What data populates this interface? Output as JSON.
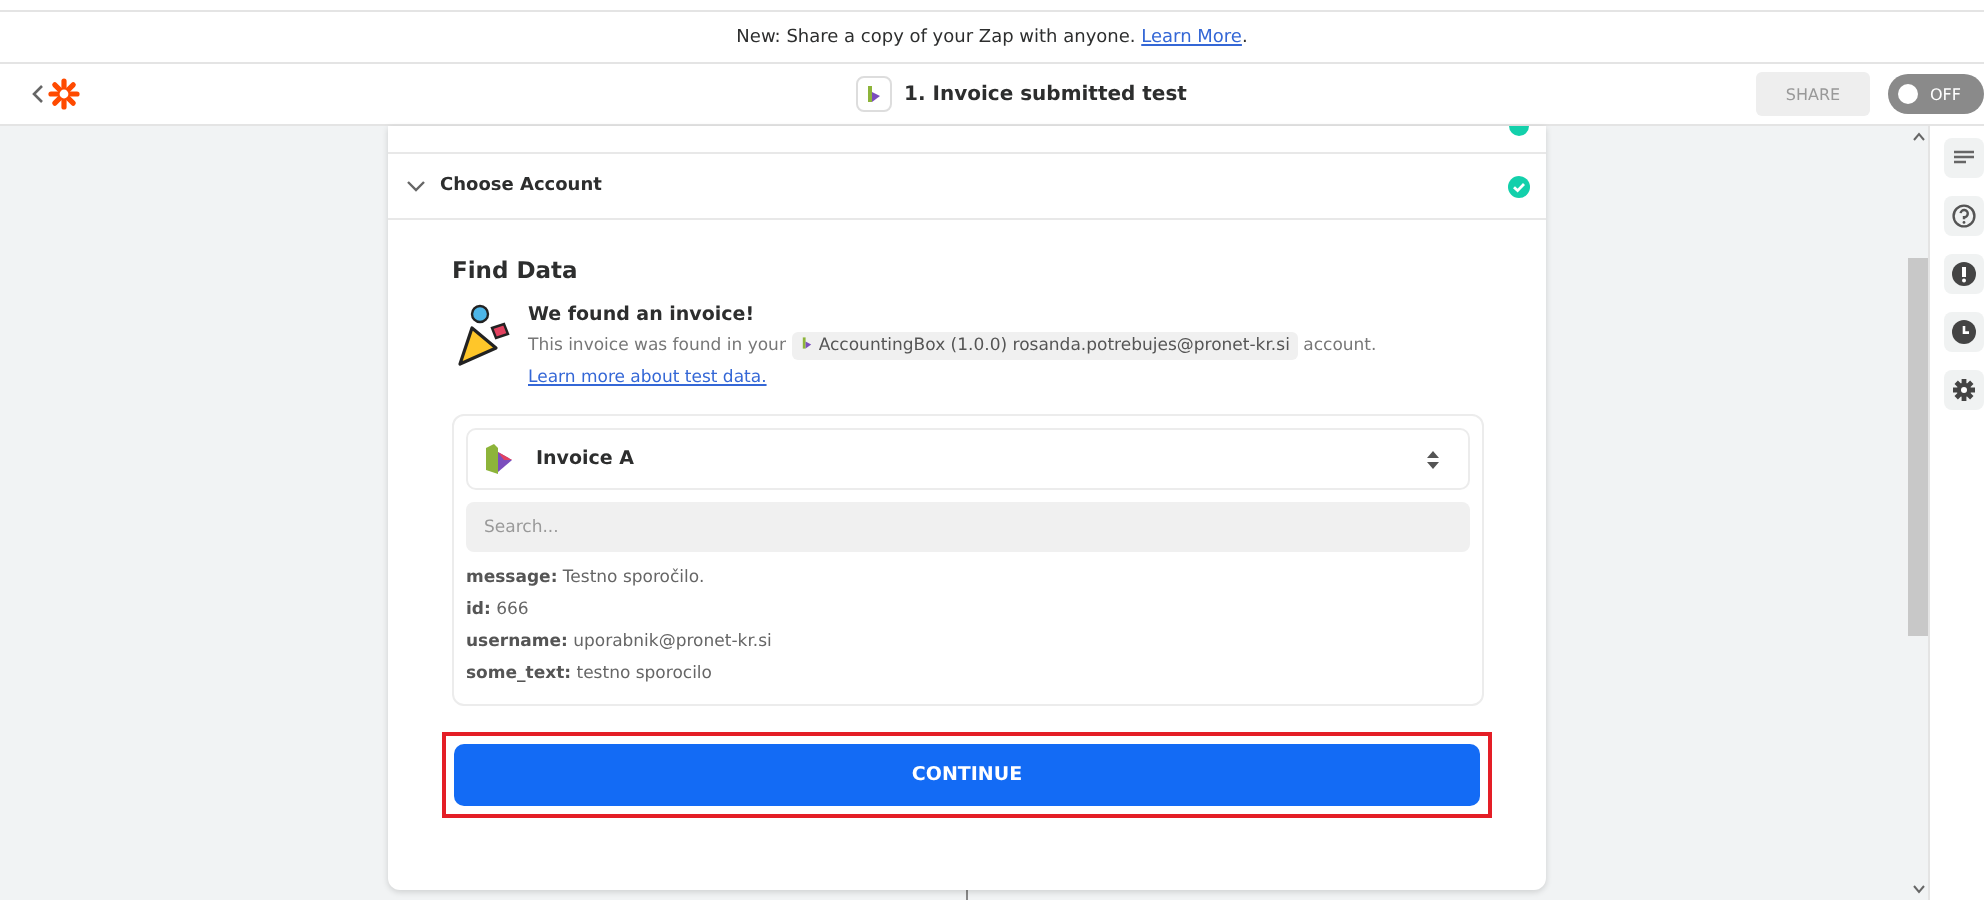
{
  "banner": {
    "text": "New: Share a copy of your Zap with anyone.",
    "link": "Learn More",
    "after": "."
  },
  "header": {
    "title": "1. Invoice submitted test",
    "share": "SHARE",
    "toggle": {
      "label": "OFF",
      "on": false
    }
  },
  "steps": [
    {
      "kind": "hidden",
      "completed": true
    },
    {
      "kind": "open",
      "label": "Choose Account",
      "completed": true
    }
  ],
  "find_data": {
    "heading": "Find Data",
    "title": "We found an invoice!",
    "text_before": "This invoice was found in your",
    "account": "AccountingBox (1.0.0) rosanda.potrebujes@pronet-kr.si",
    "text_after": "account.",
    "link": "Learn more about test data.",
    "select": "Invoice A",
    "search": {
      "placeholder": "Search..."
    },
    "fields": [
      {
        "key": "message:",
        "value": "Testno sporočilo."
      },
      {
        "key": "id:",
        "value": "666"
      },
      {
        "key": "username:",
        "value": "uporabnik@pronet-kr.si"
      },
      {
        "key": "some_text:",
        "value": "testno sporocilo"
      }
    ]
  },
  "continue": {
    "label": "CONTINUE",
    "highlighted": true
  }
}
